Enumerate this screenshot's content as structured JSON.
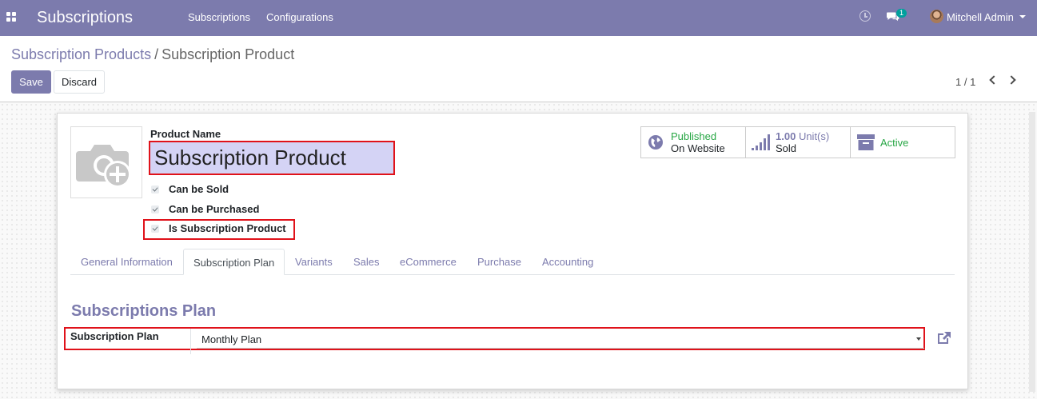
{
  "navbar": {
    "app_title": "Subscriptions",
    "menu": [
      "Subscriptions",
      "Configurations"
    ],
    "chat_badge": "1",
    "user_name": "Mitchell Admin"
  },
  "breadcrumb": {
    "parent": "Subscription Products",
    "separator": "/",
    "current": "Subscription Product"
  },
  "actions": {
    "save_label": "Save",
    "discard_label": "Discard"
  },
  "pager": {
    "value": "1 / 1"
  },
  "form": {
    "name_label": "Product Name",
    "name_value": "Subscription Product",
    "checkboxes": [
      {
        "label": "Can be Sold",
        "checked": true
      },
      {
        "label": "Can be Purchased",
        "checked": true
      },
      {
        "label": "Is Subscription Product",
        "checked": true
      }
    ],
    "smart_buttons": {
      "published_line1": "Published",
      "published_line2": "On Website",
      "sold_value": "1.00",
      "sold_unit": "Unit(s)",
      "sold_line2": "Sold",
      "active_label": "Active"
    },
    "tabs": [
      "General Information",
      "Subscription Plan",
      "Variants",
      "Sales",
      "eCommerce",
      "Purchase",
      "Accounting"
    ],
    "active_tab": "Subscription Plan",
    "section_title": "Subscriptions Plan",
    "plan_label": "Subscription Plan",
    "plan_value": "Monthly Plan"
  },
  "colors": {
    "brand": "#7c7bad",
    "highlight_border": "#e0121a",
    "published_green": "#28a745",
    "name_input_bg": "#d4d3f5"
  },
  "icons": [
    "apps-icon",
    "clock-icon",
    "chat-icon",
    "avatar",
    "camera-add-icon",
    "globe-icon",
    "bar-chart-icon",
    "archive-icon",
    "external-link-icon",
    "chevron-left-icon",
    "chevron-right-icon"
  ]
}
